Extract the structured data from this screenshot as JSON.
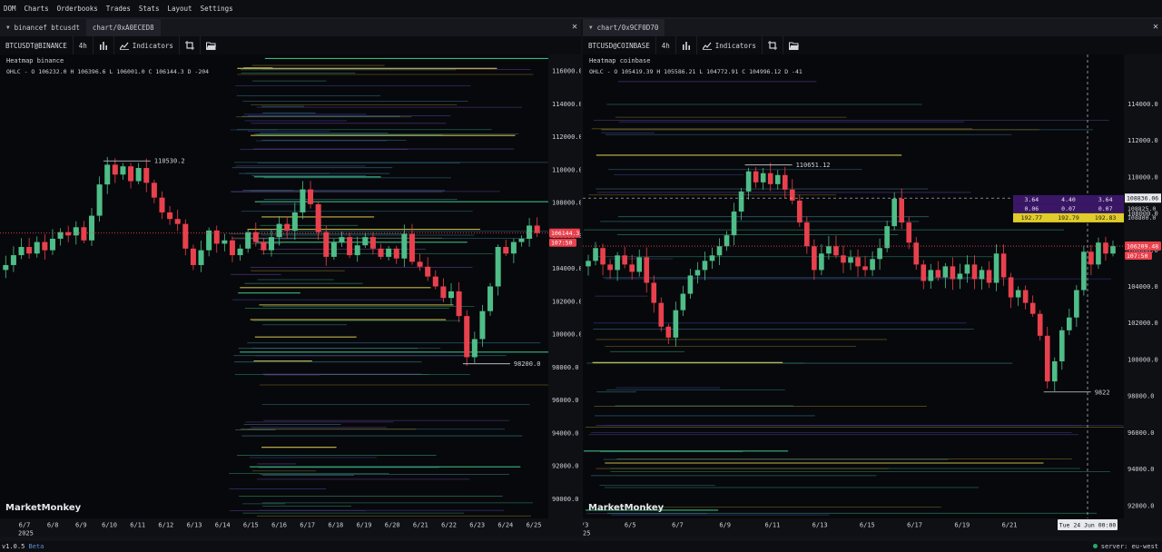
{
  "menu": [
    "DOM",
    "Charts",
    "Orderbooks",
    "Trades",
    "Stats",
    "Layout",
    "Settings"
  ],
  "left_pane": {
    "tabs": [
      {
        "label": "binancef btcusdt",
        "active": false
      },
      {
        "label": "chart/0xA0ECED8",
        "active": true
      }
    ],
    "symbol": "BTCUSDT@BINANCE",
    "timeframe": "4h",
    "indicators_label": "Indicators",
    "heatmap_label": "Heatmap binance",
    "ohlc": "OHLC - O 106232.0 H 106396.6 L 106001.0 C 106144.3 D -204",
    "brand": "MarketMonkey",
    "chart_data": {
      "type": "candlestick",
      "ylim": [
        88800,
        117000
      ],
      "price_ticks": [
        "116000.0",
        "114000.0",
        "112000.0",
        "110000.0",
        "108000.0",
        "106000.0",
        "104000.0",
        "102000.0",
        "100000.0",
        "98000.0",
        "96000.0",
        "94000.0",
        "92000.0",
        "90000.0"
      ],
      "date_ticks": [
        "6/7",
        "6/8",
        "6/9",
        "6/10",
        "6/11",
        "6/12",
        "6/13",
        "6/14",
        "6/15",
        "6/16",
        "6/17",
        "6/18",
        "6/19",
        "6/20",
        "6/21",
        "6/22",
        "6/23",
        "6/24",
        "6/25"
      ],
      "year_label": "2025",
      "high_annotation": "110530.2",
      "high_value": 110530.2,
      "low_annotation": "98200.0",
      "low_value": 98200,
      "last_price": "106144.3",
      "last_value": 106144.3,
      "countdown": "107:50",
      "closes": [
        104200,
        104800,
        105300,
        104900,
        105600,
        105100,
        105800,
        106200,
        106000,
        106500,
        105700,
        107200,
        109100,
        110300,
        109700,
        110200,
        109300,
        110100,
        109200,
        108300,
        107400,
        107000,
        106700,
        105200,
        104200,
        105100,
        106300,
        105500,
        105700,
        104800,
        105200,
        106200,
        105600,
        105100,
        105900,
        106700,
        106300,
        107400,
        108800,
        107900,
        106200,
        104700,
        105600,
        105900,
        104800,
        105400,
        105900,
        105200,
        104700,
        105200,
        104600,
        106100,
        104400,
        104100,
        103500,
        102900,
        102200,
        102600,
        101100,
        98600,
        99700,
        101400,
        102900,
        105300,
        104900,
        105600,
        105800,
        106600,
        106144
      ]
    }
  },
  "right_pane": {
    "tabs": [
      {
        "label": "chart/0x9CF0D70",
        "active": true
      }
    ],
    "symbol": "BTCUSD@COINBASE",
    "timeframe": "4h",
    "indicators_label": "Indicators",
    "heatmap_label": "Heatmap coinbase",
    "ohlc": "OHLC - O 105419.39 H 105586.21 L 104772.91 C 104996.12 D -41",
    "brand": "MarketMonkey",
    "chart_data": {
      "type": "candlestick",
      "ylim": [
        91300,
        116700
      ],
      "price_ticks": [
        "114000.0",
        "112000.0",
        "110000.0",
        "108000.0",
        "106000.0",
        "104000.0",
        "102000.0",
        "100000.0",
        "98000.0",
        "96000.0",
        "94000.0",
        "92000.0"
      ],
      "date_ticks": [
        "6/3",
        "6/5",
        "6/7",
        "6/9",
        "6/11",
        "6/13",
        "6/15",
        "6/17",
        "6/19",
        "6/21"
      ],
      "year_label": "25",
      "high_annotation": "110651.12",
      "high_value": 110651.12,
      "low_annotation": "9822",
      "low_value": 98220,
      "last_price": "106209.48",
      "last_value": 106209.48,
      "countdown": "107:50",
      "crosshair_price": "108836.06",
      "crosshair_value": 108836.06,
      "crosshair_time": "Tue 24 Jun 00:00",
      "mini_ticks": [
        "108850.0",
        "108825.0",
        "108800.0"
      ],
      "footprint_rows": [
        [
          "3.64",
          "4.40",
          "3.64"
        ],
        [
          "0.06",
          "0.07",
          "0.07"
        ],
        [
          "192.77",
          "192.79",
          "192.83"
        ]
      ],
      "closes": [
        105400,
        106100,
        105200,
        104900,
        105700,
        105200,
        104800,
        105600,
        104200,
        103100,
        101800,
        101200,
        102700,
        103600,
        104600,
        104900,
        105400,
        105700,
        106200,
        106800,
        108100,
        109200,
        110300,
        109700,
        110200,
        109600,
        110100,
        109300,
        108700,
        107500,
        106200,
        104900,
        105800,
        106200,
        105700,
        105300,
        105600,
        105100,
        104900,
        105500,
        106100,
        107300,
        108800,
        107500,
        106400,
        105200,
        104300,
        104900,
        104500,
        105100,
        104400,
        104700,
        105200,
        104400,
        104900,
        104200,
        105800,
        104500,
        103400,
        103800,
        103100,
        102500,
        101300,
        98800,
        99900,
        101600,
        102300,
        103800,
        105900,
        105200,
        106400,
        105800,
        106209
      ]
    }
  },
  "footer": {
    "version": "v1.0.5",
    "beta": "Beta",
    "server": "server: eu-west"
  },
  "colors": {
    "up": "#4fbd88",
    "down": "#e8414d",
    "bg": "#07080b",
    "axis": "#0f1014",
    "last": "#e8414d"
  }
}
